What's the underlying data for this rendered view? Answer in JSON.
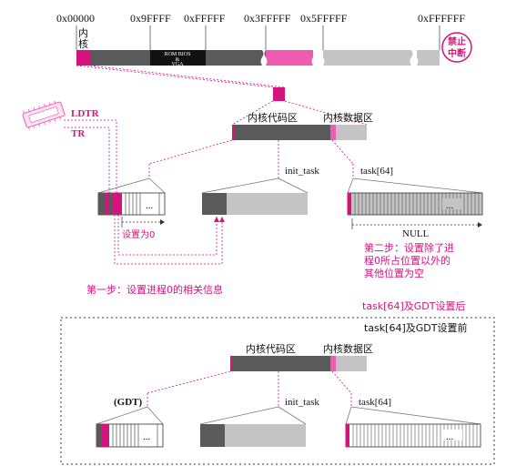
{
  "memory_map": {
    "addresses": [
      "0x00000",
      "0x9FFFF",
      "0xFFFFF",
      "0x3FFFFF",
      "0x5FFFFF",
      "0xFFFFFF"
    ],
    "kernel_label": "内\n核",
    "rom_bios": [
      "ROM BIOS",
      "&",
      "VGA"
    ],
    "interrupt_badge": [
      "禁止",
      "中断"
    ]
  },
  "cpu_registers": [
    "LDTR",
    "TR"
  ],
  "after": {
    "kernel_code": "内核代码区",
    "kernel_data": "内核数据区",
    "init_task": "init_task",
    "task_array": "task[64]",
    "set_zero": "设置为0",
    "null_label": "NULL",
    "ellipsis": "...",
    "step2": [
      "第二步：设置除了进",
      "程0所占位置以外的",
      "其他位置为空"
    ],
    "step1": "第一步：设置进程0的相关信息",
    "caption": "task[64]及GDT设置后"
  },
  "before": {
    "caption": "task[64]及GDT设置前",
    "kernel_code": "内核代码区",
    "kernel_data": "内核数据区",
    "gdt": "(GDT)",
    "init_task": "init_task",
    "task_array": "task[64]",
    "ellipsis": "..."
  },
  "colors": {
    "magenta": "#d4137e",
    "pink": "#ee5bb0",
    "dark_gray": "#5a5a5a",
    "light_gray": "#c4c4c4"
  }
}
